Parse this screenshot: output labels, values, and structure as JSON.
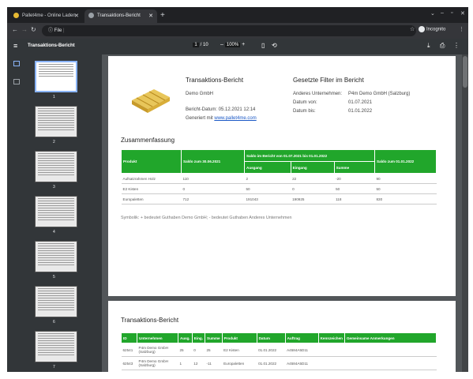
{
  "browser": {
    "tabs": [
      {
        "label": "Pallet4me - Online Laden"
      },
      {
        "label": "Transaktions-Bericht"
      }
    ],
    "address": "File",
    "incognito": "Incognito"
  },
  "pdf": {
    "title": "Transaktions-Bericht",
    "page_current": "1",
    "page_total": "/ 10",
    "zoom": "100%",
    "thumb_labels": [
      "1",
      "2",
      "3",
      "4",
      "5",
      "6",
      "7"
    ]
  },
  "report": {
    "title": "Transaktions-Bericht",
    "company": "Demo GmbH",
    "date": "Bericht-Datum: 05.12.2021 12:14",
    "generated_prefix": "Generiert mit ",
    "generated_link": "www.pallet4me.com",
    "filter_title": "Gesetzte Filter im Bericht",
    "filter_rows": [
      [
        "Anderes Unternehmen:",
        "P4m Demo GmbH (Salzburg)"
      ],
      [
        "Datum von:",
        "01.07.2021"
      ],
      [
        "Datum bis:",
        "01.01.2022"
      ]
    ],
    "summary_title": "Zusammenfassung",
    "summary_headers": {
      "produkt": "Produkt",
      "saldo_start": "Saldo zum 30.06.2021",
      "period": "Saldo im Bericht von 01.07.2021 bis 01.01.2022",
      "ausgang": "Ausgang",
      "eingang": "Eingang",
      "summe": "Summe",
      "saldo_end": "Saldo zum 01.01.2022"
    },
    "summary_rows": [
      [
        "Aufsatzrahmen Holz",
        "110",
        "2",
        "22",
        "-20",
        "90"
      ],
      [
        "E2 Kisten",
        "0",
        "50",
        "0",
        "50",
        "50"
      ],
      [
        "Europaletten",
        "712",
        "191043",
        "190925",
        "118",
        "830"
      ]
    ],
    "note": "Symbolik: + bedeutet Guthaben Demo GmbH; - bedeutet Guthaben Anderes Unternehmen",
    "tx_title": "Transaktions-Bericht",
    "tx_headers": [
      "ID",
      "Unternehmen",
      "Ausg.",
      "Eing.",
      "Summe",
      "Produkt",
      "Datum",
      "Auftrag",
      "Kennzeichen",
      "Gemeinsame Anmerkungen"
    ],
    "tx_rows": [
      [
        "62541",
        "P4m Demo GmbH (Salzburg)",
        "25",
        "0",
        "25",
        "E2 Kisten",
        "01.01.2022",
        "A4584A5D11",
        "",
        ""
      ],
      [
        "62543",
        "P4m Demo GmbH (Salzburg)",
        "1",
        "12",
        "-11",
        "Europaletten",
        "01.01.2022",
        "A4584A5D11",
        "",
        ""
      ]
    ]
  }
}
